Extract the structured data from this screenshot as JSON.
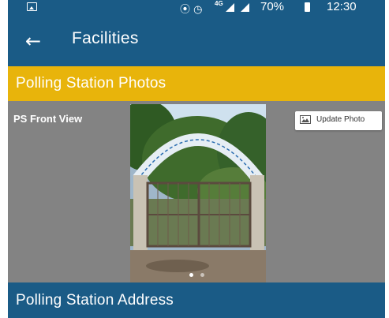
{
  "status_bar": {
    "battery": "70%",
    "time": "12:30",
    "network": "4G",
    "icons": [
      "image-icon",
      "hotspot-icon",
      "alarm-icon",
      "signal-icon",
      "battery-icon"
    ]
  },
  "app_bar": {
    "title": "Facilities",
    "back_icon": "arrow-left-icon"
  },
  "sections": {
    "photos": {
      "title": "Polling Station Photos",
      "label": "PS Front View",
      "update_button": "Update Photo",
      "carousel": {
        "count": 2,
        "current": 1
      }
    },
    "address": {
      "title": "Polling Station Address"
    }
  },
  "colors": {
    "primary": "#1a5b86",
    "accent": "#e8b40b",
    "panel": "#838383"
  }
}
